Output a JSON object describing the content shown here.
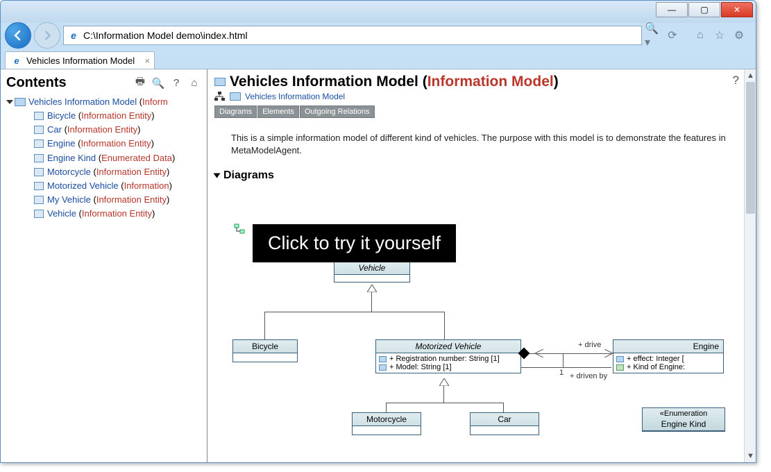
{
  "window": {
    "minimize": "—",
    "maximize": "▢",
    "close": "✕"
  },
  "address": {
    "url": "C:\\Information Model demo\\index.html",
    "search_refresh": "⟳"
  },
  "tab": {
    "title": "Vehicles Information Model"
  },
  "sidebar": {
    "title": "Contents",
    "root": {
      "text": "Vehicles Information Model",
      "type_prefix": " (",
      "type": "Inform"
    },
    "items": [
      {
        "name": "Bicycle",
        "type": "Information Entity"
      },
      {
        "name": "Car",
        "type": "Information Entity"
      },
      {
        "name": "Engine",
        "type": "Information Entity"
      },
      {
        "name": "Engine Kind",
        "type": "Enumerated Data"
      },
      {
        "name": "Motorcycle",
        "type": "Information Entity"
      },
      {
        "name": "Motorized Vehicle",
        "type": "Information"
      },
      {
        "name": "My Vehicle",
        "type": "Information Entity"
      },
      {
        "name": "Vehicle",
        "type": "Information Entity"
      }
    ]
  },
  "main": {
    "title_prefix": "Vehicles Information Model (",
    "title_type": "Information Model",
    "title_suffix": ")",
    "breadcrumb": "Vehicles Information Model",
    "sections": {
      "diagrams": "Diagrams",
      "elements": "Elements",
      "outgoing": "Outgoing Relations"
    },
    "description": "This is a simple information model of different kind of vehicles. The purpose with this model is to demonstrate the features in MetaModelAgent.",
    "diagrams_heading": "Diagrams"
  },
  "overlay": {
    "text": "Click to try it yourself"
  },
  "uml": {
    "vehicle": "Vehicle",
    "bicycle": "Bicycle",
    "motorized": {
      "name": "Motorized Vehicle",
      "attr1": "+ Registration number: String [1]",
      "attr2": "+ Model: String [1]"
    },
    "motorcycle": "Motorcycle",
    "car": "Car",
    "engine": {
      "name": "Engine",
      "attr1": "+ effect: Integer [",
      "attr2": "+ Kind of Engine:"
    },
    "enginekind": {
      "stereo": "«Enumeration",
      "name": "Engine Kind"
    },
    "labels": {
      "drives": "+ drive",
      "drivenby": "+ driven by",
      "one": "1"
    }
  }
}
